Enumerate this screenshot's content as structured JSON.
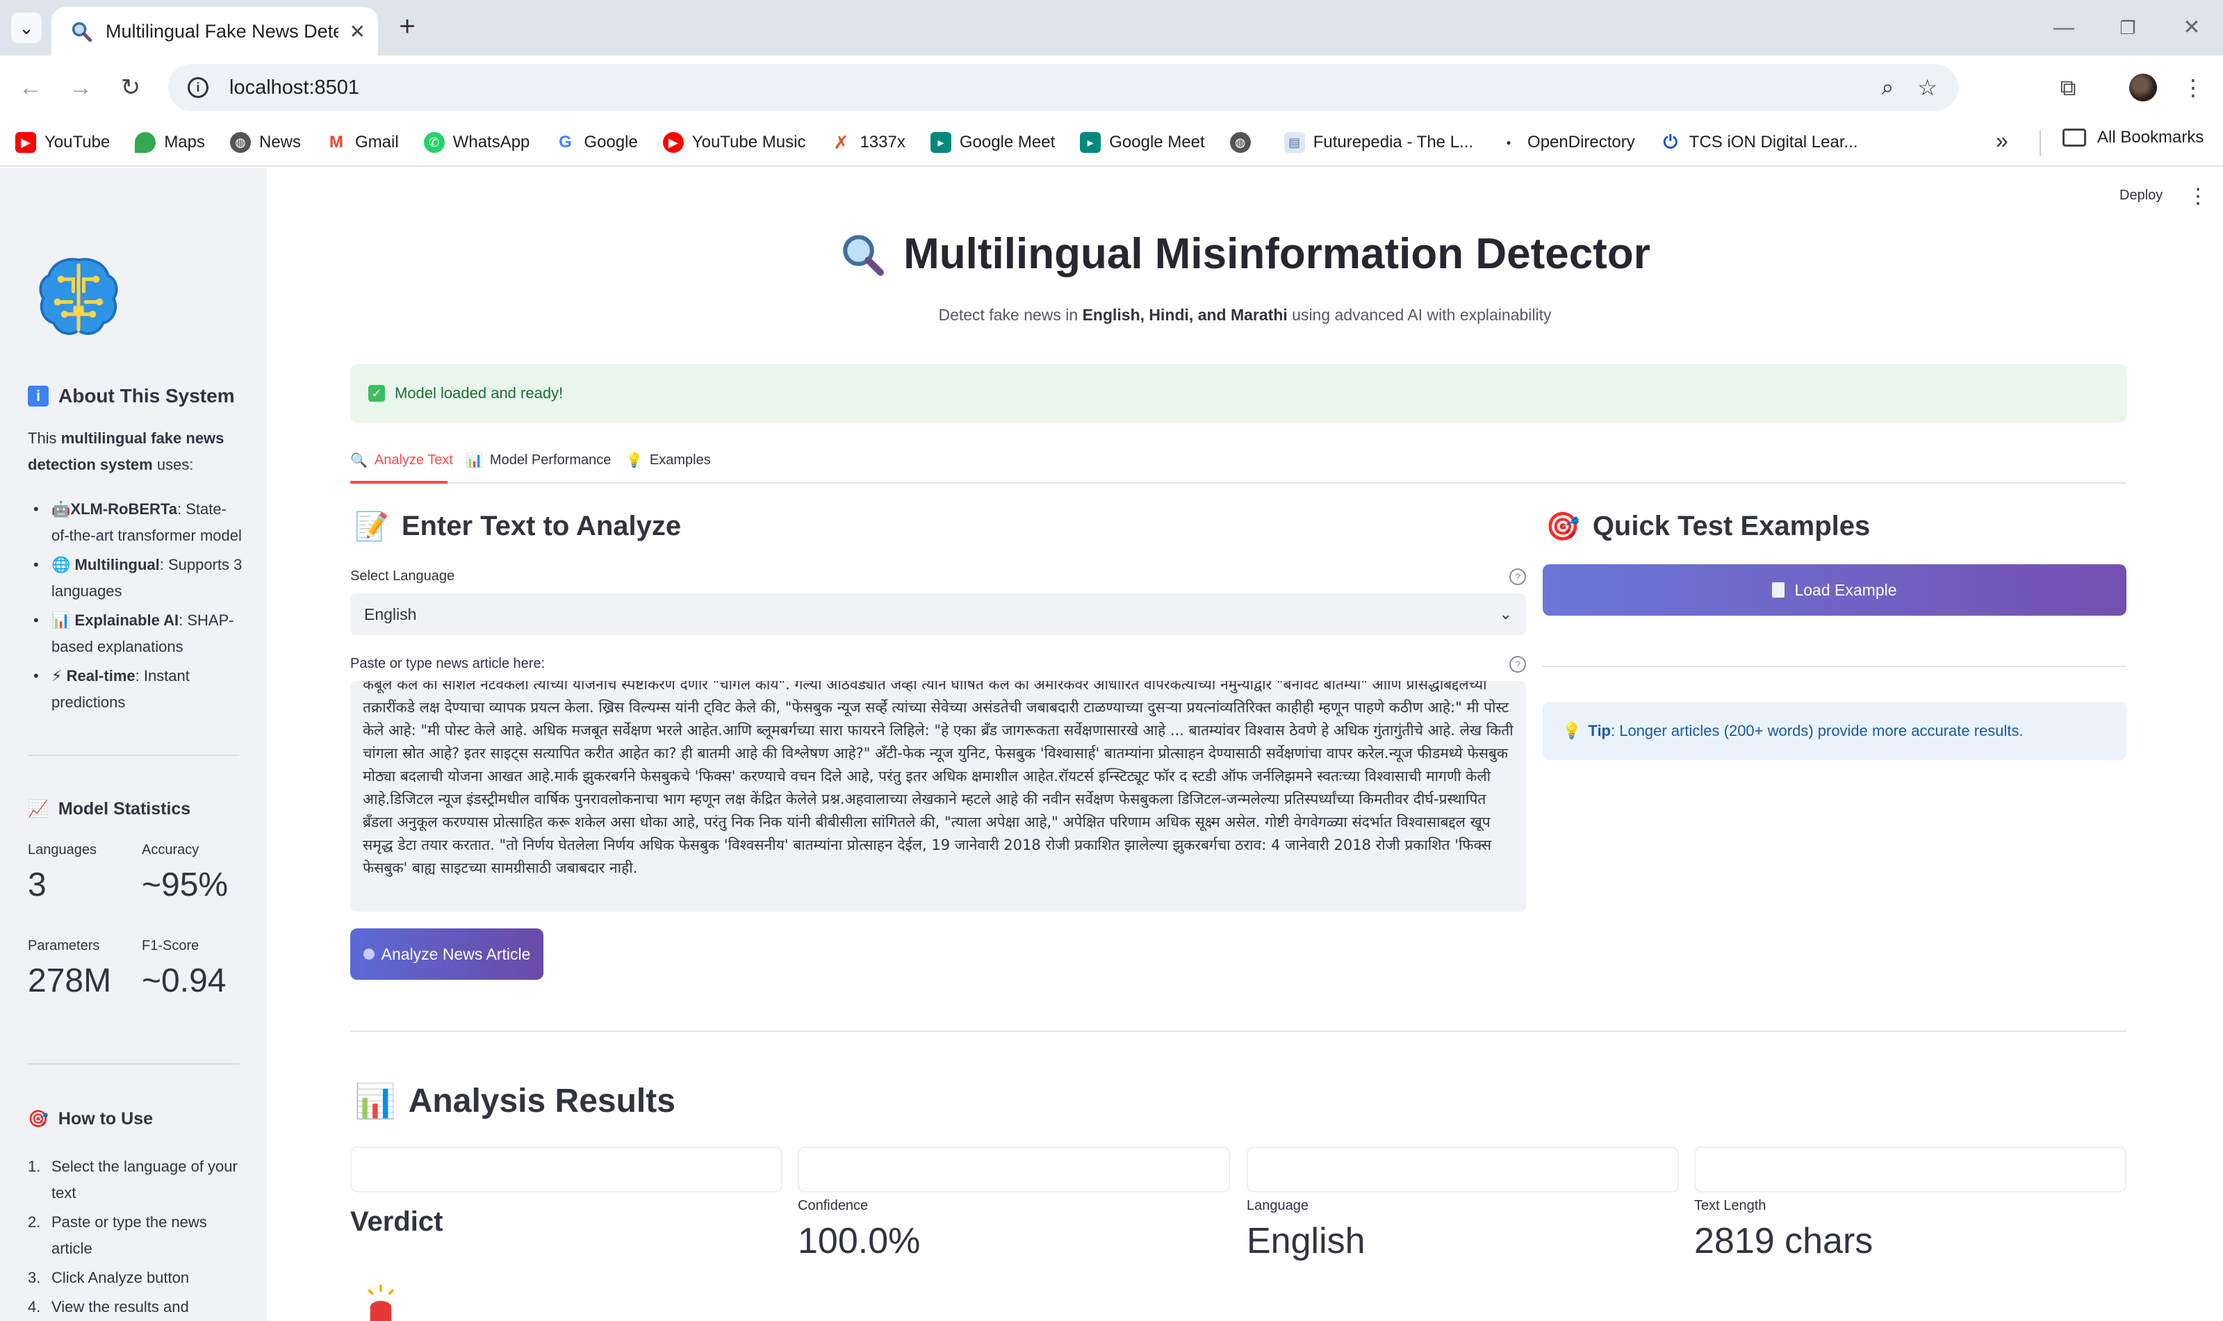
{
  "browser": {
    "tab_title": "Multilingual Fake News Detecto",
    "url": "localhost:8501",
    "bookmarks": [
      "YouTube",
      "Maps",
      "News",
      "Gmail",
      "WhatsApp",
      "Google",
      "YouTube Music",
      "1337x",
      "Google Meet",
      "Google Meet",
      "",
      "Futurepedia - The L...",
      "OpenDirectory",
      "TCS iON Digital Lear..."
    ],
    "all_bookmarks": "All Bookmarks"
  },
  "sidebar": {
    "about_title": "About This System",
    "about_intro_pre": "This ",
    "about_intro_bold": "multilingual fake news detection system",
    "about_intro_post": " uses:",
    "features": [
      {
        "bold": "XLM-RoBERTa",
        "text": ": State-of-the-art transformer model",
        "icon": "🤖"
      },
      {
        "bold": "Multilingual",
        "text": ": Supports 3 languages",
        "icon": "🌐"
      },
      {
        "bold": "Explainable AI",
        "text": ": SHAP-based explanations",
        "icon": "📊"
      },
      {
        "bold": "Real-time",
        "text": ": Instant predictions",
        "icon": "⚡"
      }
    ],
    "stats_title": "Model Statistics",
    "stats": {
      "languages_label": "Languages",
      "languages_value": "3",
      "accuracy_label": "Accuracy",
      "accuracy_value": "~95%",
      "parameters_label": "Parameters",
      "parameters_value": "278M",
      "f1_label": "F1-Score",
      "f1_value": "~0.94"
    },
    "howto_title": "How to Use",
    "steps": [
      "Select the language of your text",
      "Paste or type the news article",
      "Click Analyze button",
      "View the results and"
    ]
  },
  "header": {
    "deploy": "Deploy",
    "title": "Multilingual Misinformation Detector",
    "subtitle_pre": "Detect fake news in ",
    "subtitle_bold": "English, Hindi, and Marathi",
    "subtitle_post": " using advanced AI with explainability",
    "status": "Model loaded and ready!"
  },
  "tabs": [
    "Analyze Text",
    "Model Performance",
    "Examples"
  ],
  "analyze": {
    "heading": "Enter Text to Analyze",
    "language_label": "Select Language",
    "language_value": "English",
    "text_label": "Paste or type news article here:",
    "text_value": "कबूल केले की सोशल नेटवर्कला त्यांच्या योजनांचे स्पष्टीकरण देणार \"चांगले काय\". गेल्या आठवड्यात जेव्हा त्याने घोषित केले की अमेरिकेवर आधारित वापरकर्त्यांच्या नमुन्याद्वारे \"बनावट बातम्या\" आणि प्रसिद्धीबद्दलच्या तक्रारींकडे लक्ष देण्याचा व्यापक प्रयत्न केला. ख्रिस विल्यम्स यांनी ट्विट केले की, \"फेसबुक न्यूज सर्व्हे त्यांच्या सेवेच्या असंडतेची जबाबदारी टाळण्याच्या दुसऱ्या प्रयत्नांव्यतिरिक्त काहीही म्हणून पाहणे कठीण आहे:\" मी पोस्ट केले आहे: \"मी पोस्ट केले आहे. अधिक मजबूत सर्वेक्षण भरले आहेत.आणि ब्लूमबर्गच्या सारा फायरने लिहिले: \"हे एका ब्रँड जागरूकता सर्वेक्षणासारखे आहे ... बातम्यांवर विश्वास ठेवणे हे अधिक गुंतागुंतीचे आहे. लेख किती चांगला स्रोत आहे? इतर साइट्स सत्यापित करीत आहेत का? ही बातमी आहे की विश्लेषण आहे?\" अँटी-फेक न्यूज युनिट, फेसबुक 'विश्वासार्ह' बातम्यांना प्रोत्साहन देण्यासाठी सर्वेक्षणांचा वापर करेल.न्यूज फीडमध्ये फेसबुक मोठ्या बदलाची योजना आखत आहे.मार्क झुकरबर्गने फेसबुकचे 'फिक्स' करण्याचे वचन दिले आहे, परंतु इतर अधिक क्षमाशील आहेत.रॉयटर्स इन्स्टिट्यूट फॉर द स्टडी ऑफ जर्नलिझमने स्वतःच्या विश्वासाची मागणी केली आहे.डिजिटल न्यूज इंडस्ट्रीमधील वार्षिक पुनरावलोकनाचा भाग म्हणून लक्ष केंद्रित केलेले प्रश्न.अहवालाच्या लेखकाने म्हटले आहे की नवीन सर्वेक्षण फेसबुकला डिजिटल-जन्मलेल्या प्रतिस्पर्ध्यांच्या किमतीवर दीर्घ-प्रस्थापित ब्रँडला अनुकूल करण्यास प्रोत्साहित करू शकेल असा धोका आहे, परंतु निक निक यांनी बीबीसीला सांगितले की, \"त्याला अपेक्षा आहे,\" अपेक्षित परिणाम अधिक सूक्ष्म असेल. गोष्टी वेगवेगळ्या संदर्भात विश्वासाबद्दल खूप समृद्ध डेटा तयार करतात. \"तो निर्णय घेतलेला निर्णय अधिक फेसबुक 'विश्वसनीय' बातम्यांना प्रोत्साहन देईल, 19 जानेवारी 2018 रोजी प्रकाशित झालेल्या झुकरबर्गचा ठराव: 4 जानेवारी 2018 रोजी प्रकाशित 'फिक्स फेसबुक' बाह्य साइटच्या सामग्रीसाठी जबाबदार नाही.",
    "analyze_button": "Analyze News Article"
  },
  "quick": {
    "heading": "Quick Test Examples",
    "load_button": "Load Example",
    "tip_bold": "Tip",
    "tip_text": ": Longer articles (200+ words) provide more accurate results."
  },
  "results": {
    "heading": "Analysis Results",
    "verdict_label": "Verdict",
    "confidence_label": "Confidence",
    "confidence_value": "100.0%",
    "language_label": "Language",
    "language_value": "English",
    "length_label": "Text Length",
    "length_value": "2819 chars"
  },
  "colors": {
    "accent": "#ff4b4b",
    "button_start": "#5b6bd6",
    "button_end": "#6a4aa6",
    "success_bg": "#e8f6ec",
    "info_bg": "#eaf3fc",
    "sidebar_bg": "#f0f2f6"
  }
}
